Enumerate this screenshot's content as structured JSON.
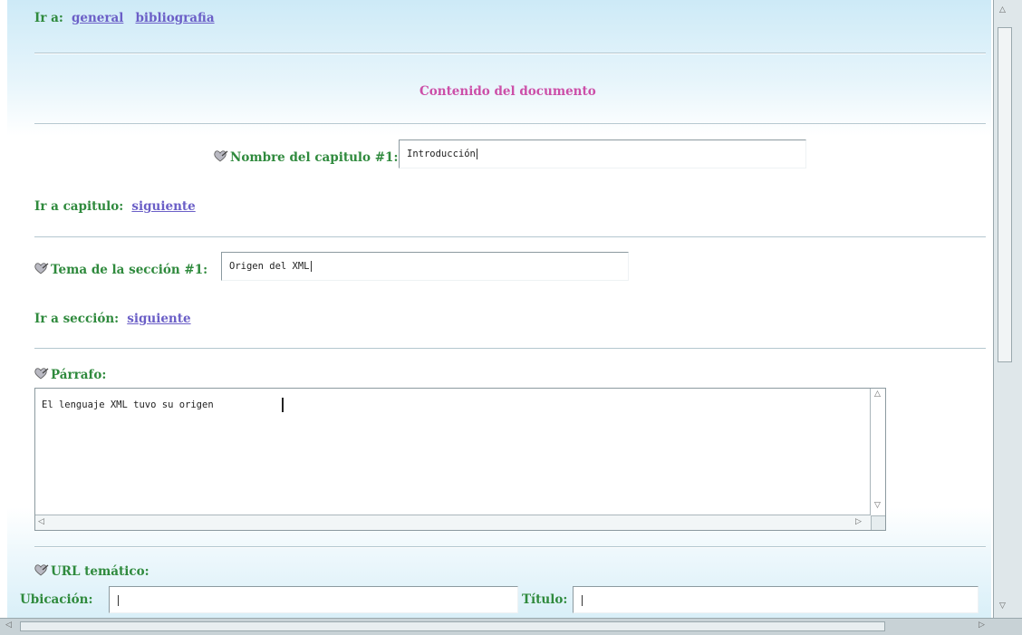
{
  "nav": {
    "go_to_label": "Ir a:",
    "links": [
      "general",
      "bibliografia"
    ]
  },
  "content_header": "Contenido del documento",
  "chapter": {
    "label": "Nombre del capitulo #1:",
    "value": "Introducción",
    "go_to_label": "Ir a capitulo:",
    "next_link": "siguiente"
  },
  "section": {
    "label": "Tema de la sección #1:",
    "value": "Origen del XML",
    "go_to_label": "Ir a sección:",
    "next_link": "siguiente"
  },
  "paragraph": {
    "label": "Párrafo:",
    "value": "El lenguaje XML tuvo su origen"
  },
  "url": {
    "label": "URL temático:",
    "location_label": "Ubicación:",
    "title_label": "Título:"
  },
  "icons": {
    "bullet": "heart-pencil-icon"
  },
  "colors": {
    "label_green": "#2f8a3d",
    "link_purple": "#6b5fc7",
    "header_pink": "#cc4fa8"
  }
}
